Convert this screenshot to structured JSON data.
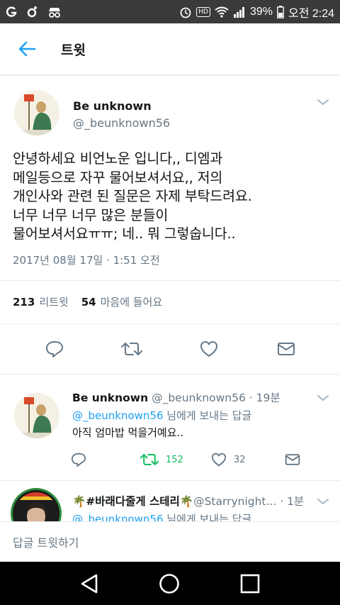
{
  "status_bar": {
    "battery": "39%",
    "time": "오전 2:24",
    "hd_label": "HD"
  },
  "header": {
    "title": "트윗"
  },
  "main_tweet": {
    "name": "Be unknown",
    "handle": "@_beunknown56",
    "text": "안녕하세요 비언노운 입니다,, 디엠과\n메일등으로 자꾸 물어보셔서요,, 저의\n개인사와 관련 된 질문은 자제 부탁드려요.\n너무 너무 너무 많은 분들이\n물어보셔서요ㅠㅠ; 네.. 뭐 그렇숩니다..",
    "timestamp": "2017년 08월 17일 · 1:51 오전",
    "retweet_count": "213",
    "retweet_label": "리트윗",
    "like_count": "54",
    "like_label": "마음에 들어요"
  },
  "replies": [
    {
      "name": "Be unknown",
      "meta": " @_beunknown56 · 19분",
      "reply_to_handle": "@_beunknown56",
      "reply_to_suffix": " 님에게 보내는 답글",
      "text": "아직 엄마밥 먹을거예요..",
      "retweet_count": "152",
      "like_count": "32"
    },
    {
      "name": "🌴#바래다줄게 스테리🌴",
      "meta": "@Starrynight... · 1분",
      "reply_to_handle": "@_beunknown56",
      "reply_to_suffix": " 님에게 보내는 답글"
    }
  ],
  "compose": {
    "placeholder": "답글 트윗하기"
  },
  "colors": {
    "accent": "#1da1f2",
    "retweet_active": "#17bf63",
    "secondary_text": "#657786"
  },
  "icons": [
    "back-arrow-icon",
    "caret-down-icon",
    "reply-icon",
    "retweet-icon",
    "heart-icon",
    "dm-envelope-icon",
    "nav-back-icon",
    "nav-home-icon",
    "nav-recents-icon"
  ]
}
